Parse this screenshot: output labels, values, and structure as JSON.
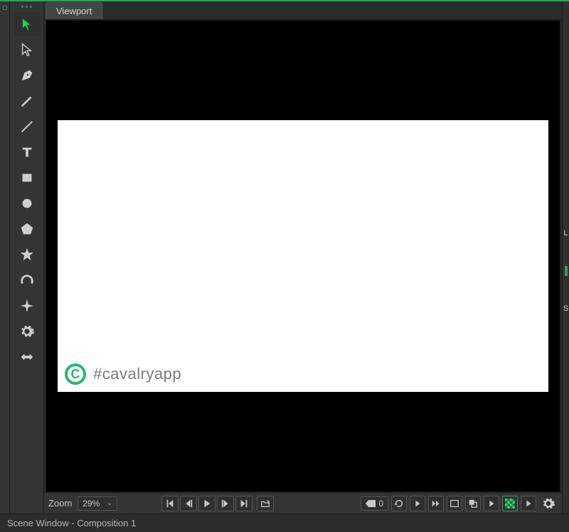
{
  "tab": {
    "viewport_label": "Viewport"
  },
  "tools": {
    "active_index": 0
  },
  "canvas": {
    "watermark_logo_letter": "C",
    "watermark_text": "#cavalryapp"
  },
  "status": {
    "zoom_label": "Zoom",
    "zoom_value": "29%",
    "frame_value": "0"
  },
  "side": {
    "l1": "L",
    "l2": "S"
  },
  "footer": {
    "panel_title": "Scene Window - Composition 1"
  }
}
